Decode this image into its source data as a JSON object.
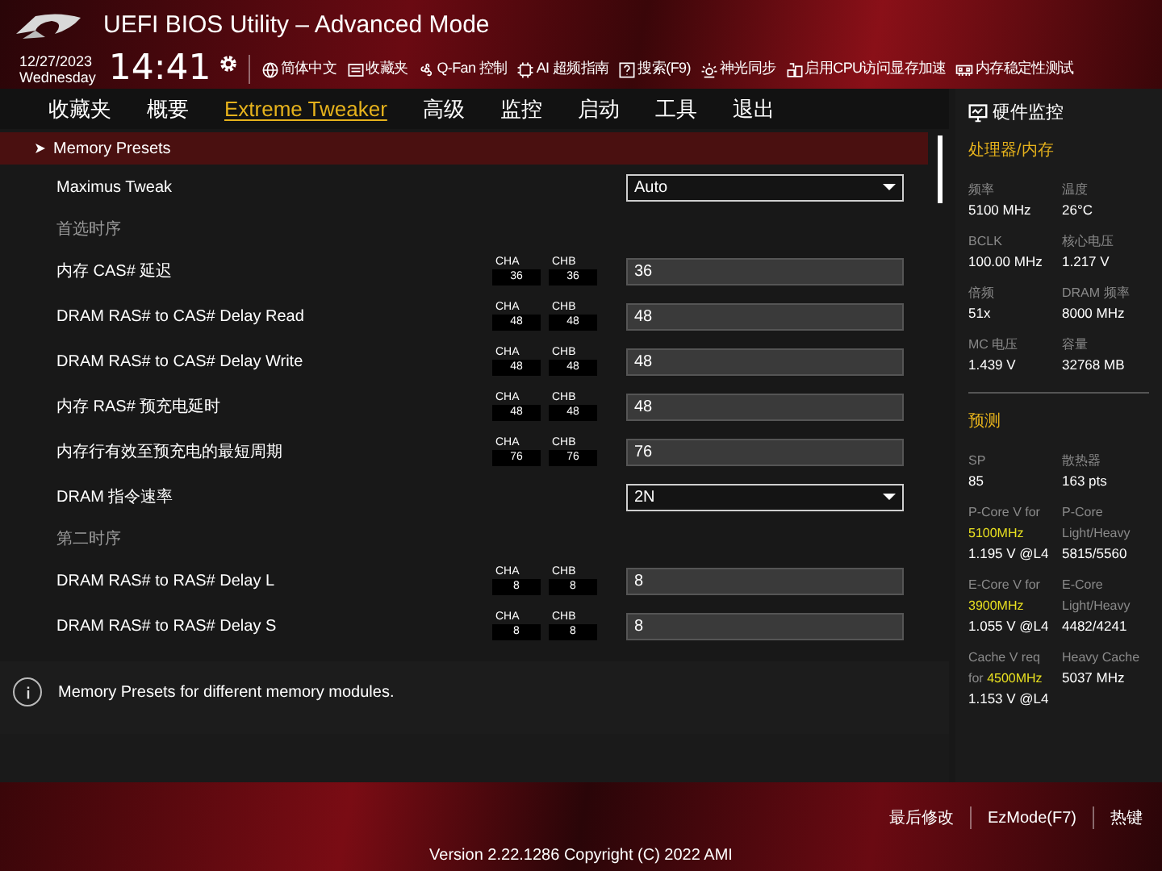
{
  "header": {
    "title": "UEFI BIOS Utility – Advanced Mode",
    "date": "12/27/2023",
    "weekday": "Wednesday",
    "time": "14:41",
    "tools": [
      {
        "label": "简体中文"
      },
      {
        "label": "收藏夹"
      },
      {
        "label": "Q-Fan 控制"
      },
      {
        "label": "AI 超频指南"
      },
      {
        "label": "搜索(F9)"
      },
      {
        "label": "神光同步"
      },
      {
        "label": "启用CPU访问显存加速"
      },
      {
        "label": "内存稳定性测试"
      }
    ]
  },
  "tabs": [
    {
      "label": "收藏夹",
      "selected": false
    },
    {
      "label": "概要",
      "selected": false
    },
    {
      "label": "Extreme Tweaker",
      "selected": true
    },
    {
      "label": "高级",
      "selected": false
    },
    {
      "label": "监控",
      "selected": false
    },
    {
      "label": "启动",
      "selected": false
    },
    {
      "label": "工具",
      "selected": false
    },
    {
      "label": "退出",
      "selected": false
    }
  ],
  "settings": [
    {
      "kind": "submenu",
      "label": "Memory Presets",
      "selected": true
    },
    {
      "kind": "dropdown",
      "label": "Maximus Tweak",
      "value": "Auto",
      "selected": false
    },
    {
      "kind": "heading",
      "label": "首选时序"
    },
    {
      "kind": "timing",
      "label": "内存 CAS# 延迟",
      "cha_label": "CHA",
      "cha": "36",
      "chb_label": "CHB",
      "chb": "36",
      "value": "36",
      "selected": false
    },
    {
      "kind": "timing",
      "label": "DRAM RAS# to CAS# Delay Read",
      "cha_label": "CHA",
      "cha": "48",
      "chb_label": "CHB",
      "chb": "48",
      "value": "48",
      "selected": false
    },
    {
      "kind": "timing",
      "label": "DRAM RAS# to CAS# Delay Write",
      "cha_label": "CHA",
      "cha": "48",
      "chb_label": "CHB",
      "chb": "48",
      "value": "48",
      "selected": false
    },
    {
      "kind": "timing",
      "label": "内存 RAS# 预充电延时",
      "cha_label": "CHA",
      "cha": "48",
      "chb_label": "CHB",
      "chb": "48",
      "value": "48",
      "selected": false
    },
    {
      "kind": "timing",
      "label": "内存行有效至预充电的最短周期",
      "cha_label": "CHA",
      "cha": "76",
      "chb_label": "CHB",
      "chb": "76",
      "value": "76",
      "selected": false
    },
    {
      "kind": "dropdown",
      "label": "DRAM 指令速率",
      "value": "2N",
      "selected": false
    },
    {
      "kind": "heading",
      "label": "第二时序"
    },
    {
      "kind": "timing",
      "label": "DRAM RAS# to RAS# Delay L",
      "cha_label": "CHA",
      "cha": "8",
      "chb_label": "CHB",
      "chb": "8",
      "value": "8",
      "selected": false
    },
    {
      "kind": "timing",
      "label": "DRAM RAS# to RAS# Delay S",
      "cha_label": "CHA",
      "cha": "8",
      "chb_label": "CHB",
      "chb": "8",
      "value": "8",
      "selected": false
    }
  ],
  "help_text": "Memory Presets for different memory modules.",
  "monitor": {
    "title": "硬件监控",
    "sections": [
      {
        "title": "处理器/内存",
        "items": [
          {
            "label": "频率",
            "value": "5100 MHz"
          },
          {
            "label": "温度",
            "value": "26°C"
          },
          {
            "label": "BCLK",
            "value": "100.00 MHz"
          },
          {
            "label": "核心电压",
            "value": "1.217 V"
          },
          {
            "label": "倍频",
            "value": "51x"
          },
          {
            "label": "DRAM 频率",
            "value": "8000 MHz"
          },
          {
            "label": "MC 电压",
            "value": "1.439 V"
          },
          {
            "label": "容量",
            "value": "32768 MB"
          }
        ]
      },
      {
        "title": "预测",
        "items": [
          {
            "label": "SP",
            "value": "85"
          },
          {
            "label": "散热器",
            "value": "163 pts"
          },
          {
            "label": "P-Core V for",
            "freq": "5100MHz",
            "value": "1.195 V @L4"
          },
          {
            "label": "P-Core Light/Heavy",
            "value": "5815/5560"
          },
          {
            "label": "E-Core V for",
            "freq": "3900MHz",
            "value": "1.055 V @L4"
          },
          {
            "label": "E-Core Light/Heavy",
            "value": "4482/4241"
          },
          {
            "label": "Cache V req for",
            "freq": "4500MHz",
            "value": "1.153 V @L4"
          },
          {
            "label": "Heavy Cache",
            "value": "5037 MHz"
          }
        ]
      }
    ]
  },
  "footer": {
    "buttons": [
      "最后修改",
      "EzMode(F7)",
      "热键"
    ],
    "version": "Version 2.22.1286 Copyright (C) 2022 AMI"
  }
}
